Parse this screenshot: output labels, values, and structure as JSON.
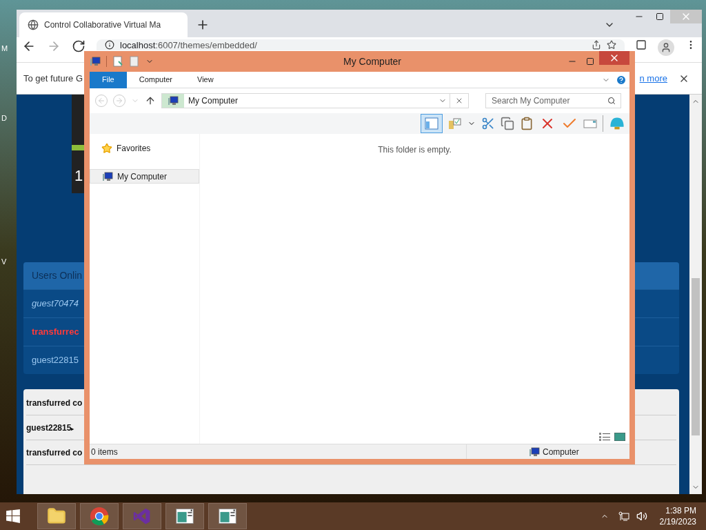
{
  "desktop": {
    "icon_labels": [
      "M",
      "D",
      "V"
    ]
  },
  "browser": {
    "tab_title": "Control Collaborative Virtual Ma",
    "url_host": "localhost",
    "url_rest": ":6007/themes/embedded/",
    "infobar": {
      "text": "To get future G",
      "link": "n more"
    },
    "page": {
      "counter": "1",
      "users_title": "Users Onlin",
      "users": [
        {
          "name": "guest70474",
          "kind": "away"
        },
        {
          "name": "transfurrec",
          "kind": "self"
        },
        {
          "name": "guest22815",
          "kind": "normal"
        }
      ],
      "messages": [
        {
          "text": "transfurred co"
        },
        {
          "text": "guest22815",
          "marker": "▸"
        },
        {
          "text": "transfurred co"
        }
      ]
    }
  },
  "explorer": {
    "title": "My Computer",
    "ribbon_tabs": [
      {
        "label": "File",
        "selected": true
      },
      {
        "label": "Computer",
        "selected": false
      },
      {
        "label": "View",
        "selected": false
      }
    ],
    "address": "My Computer",
    "search_placeholder": "Search My Computer",
    "preview_pane_on": true,
    "nav": [
      {
        "label": "Favorites",
        "kind": "favorites",
        "selected": false
      },
      {
        "label": "My Computer",
        "kind": "computer",
        "selected": true
      }
    ],
    "empty_message": "This folder is empty.",
    "status": {
      "items": "0 items",
      "location": "Computer"
    }
  },
  "taskbar": {
    "apps": [
      {
        "kind": "explorer"
      },
      {
        "kind": "chrome"
      },
      {
        "kind": "studio"
      },
      {
        "kind": "window"
      },
      {
        "kind": "window"
      }
    ],
    "time": "1:38 PM",
    "date": "2/19/2023"
  }
}
